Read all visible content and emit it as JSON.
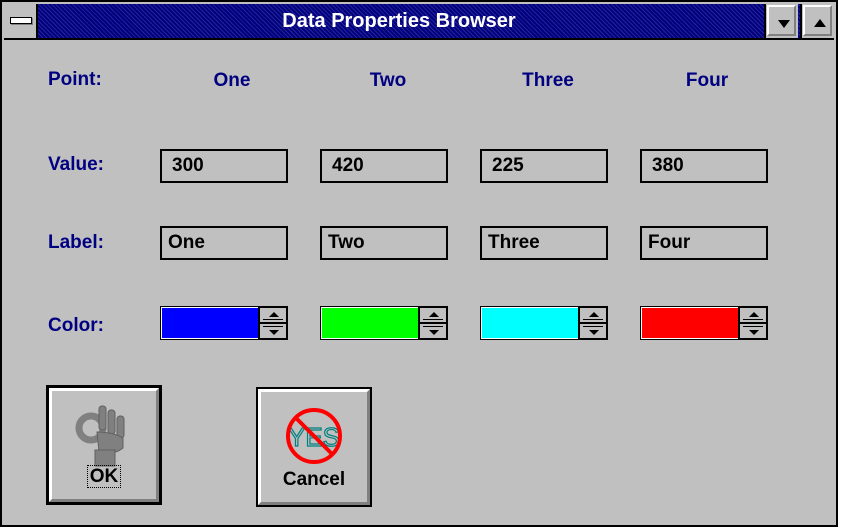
{
  "window": {
    "title": "Data Properties Browser"
  },
  "rows": {
    "point_label": "Point:",
    "value_label": "Value:",
    "label_label": "Label:",
    "color_label": "Color:"
  },
  "points": [
    {
      "name": "One",
      "value": "300",
      "label": "One",
      "color": "#0000ff"
    },
    {
      "name": "Two",
      "value": "420",
      "label": "Two",
      "color": "#00ff00"
    },
    {
      "name": "Three",
      "value": "225",
      "label": "Three",
      "color": "#00ffff"
    },
    {
      "name": "Four",
      "value": "380",
      "label": "Four",
      "color": "#ff0000"
    }
  ],
  "buttons": {
    "ok_label": "OK",
    "cancel_label": "Cancel",
    "cancel_icon_text": "YES"
  },
  "icons": {
    "system_menu": "system-menu-icon",
    "minimize": "minimize-icon",
    "maximize": "maximize-icon",
    "ok": "ok-hand-icon",
    "cancel": "no-yes-icon"
  }
}
